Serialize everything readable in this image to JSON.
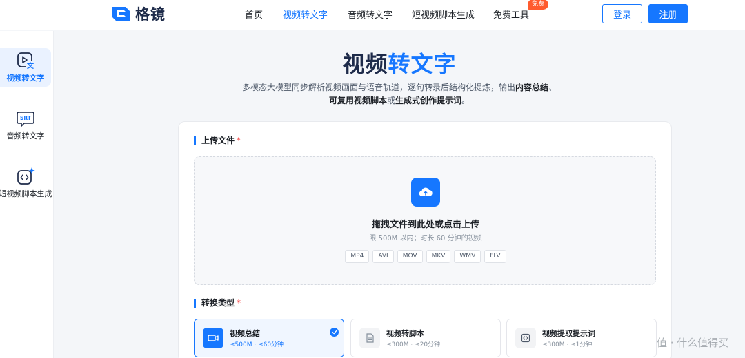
{
  "header": {
    "brand": "格镜",
    "nav": [
      {
        "label": "首页",
        "active": false
      },
      {
        "label": "视频转文字",
        "active": true
      },
      {
        "label": "音频转文字",
        "active": false
      },
      {
        "label": "短视频脚本生成",
        "active": false
      },
      {
        "label": "免费工具",
        "active": false
      }
    ],
    "free_badge": "免费",
    "login": "登录",
    "register": "注册"
  },
  "sidebar": {
    "items": [
      {
        "label": "视频转文字",
        "icon": "video-text-icon",
        "active": true
      },
      {
        "label": "音频转文字",
        "icon": "srt-icon",
        "icon_text": "SRT",
        "active": false
      },
      {
        "label": "短视频脚本生成",
        "icon": "script-sparkle-icon",
        "active": false
      }
    ]
  },
  "hero": {
    "title_dark": "视频",
    "title_accent": "转文字",
    "desc_line1": "多模态大模型同步解析视频画面与语音轨道，逐句转录后结构化提炼，输出",
    "desc_bold1": "内容总结",
    "desc_sep": "、",
    "desc_bold2": "可复用视频脚本",
    "desc_mid": "或",
    "desc_bold3": "生成式创作提示词",
    "desc_end": "。"
  },
  "upload": {
    "section_title": "上传文件",
    "required_mark": "*",
    "drop_title": "拖拽文件到此处或点击上传",
    "drop_sub": "限 500M 以内；时长 60 分钟的视频",
    "formats": [
      "MP4",
      "AVI",
      "MOV",
      "MKV",
      "WMV",
      "FLV"
    ]
  },
  "convert": {
    "section_title": "转换类型",
    "required_mark": "*",
    "types": [
      {
        "name": "视频总结",
        "meta": "≤500M · ≤60分钟",
        "icon": "video-camera-icon",
        "selected": true
      },
      {
        "name": "视频转脚本",
        "meta": "≤300M · ≤20分钟",
        "icon": "document-icon",
        "selected": false
      },
      {
        "name": "视频提取提示词",
        "meta": "≤300M · ≤1分钟",
        "icon": "code-icon",
        "selected": false
      }
    ]
  },
  "watermark": "值 · 什么值得买",
  "colors": {
    "accent": "#1677ff",
    "badge": "#ff5b2e",
    "title_dark": "#1e2b4a"
  }
}
